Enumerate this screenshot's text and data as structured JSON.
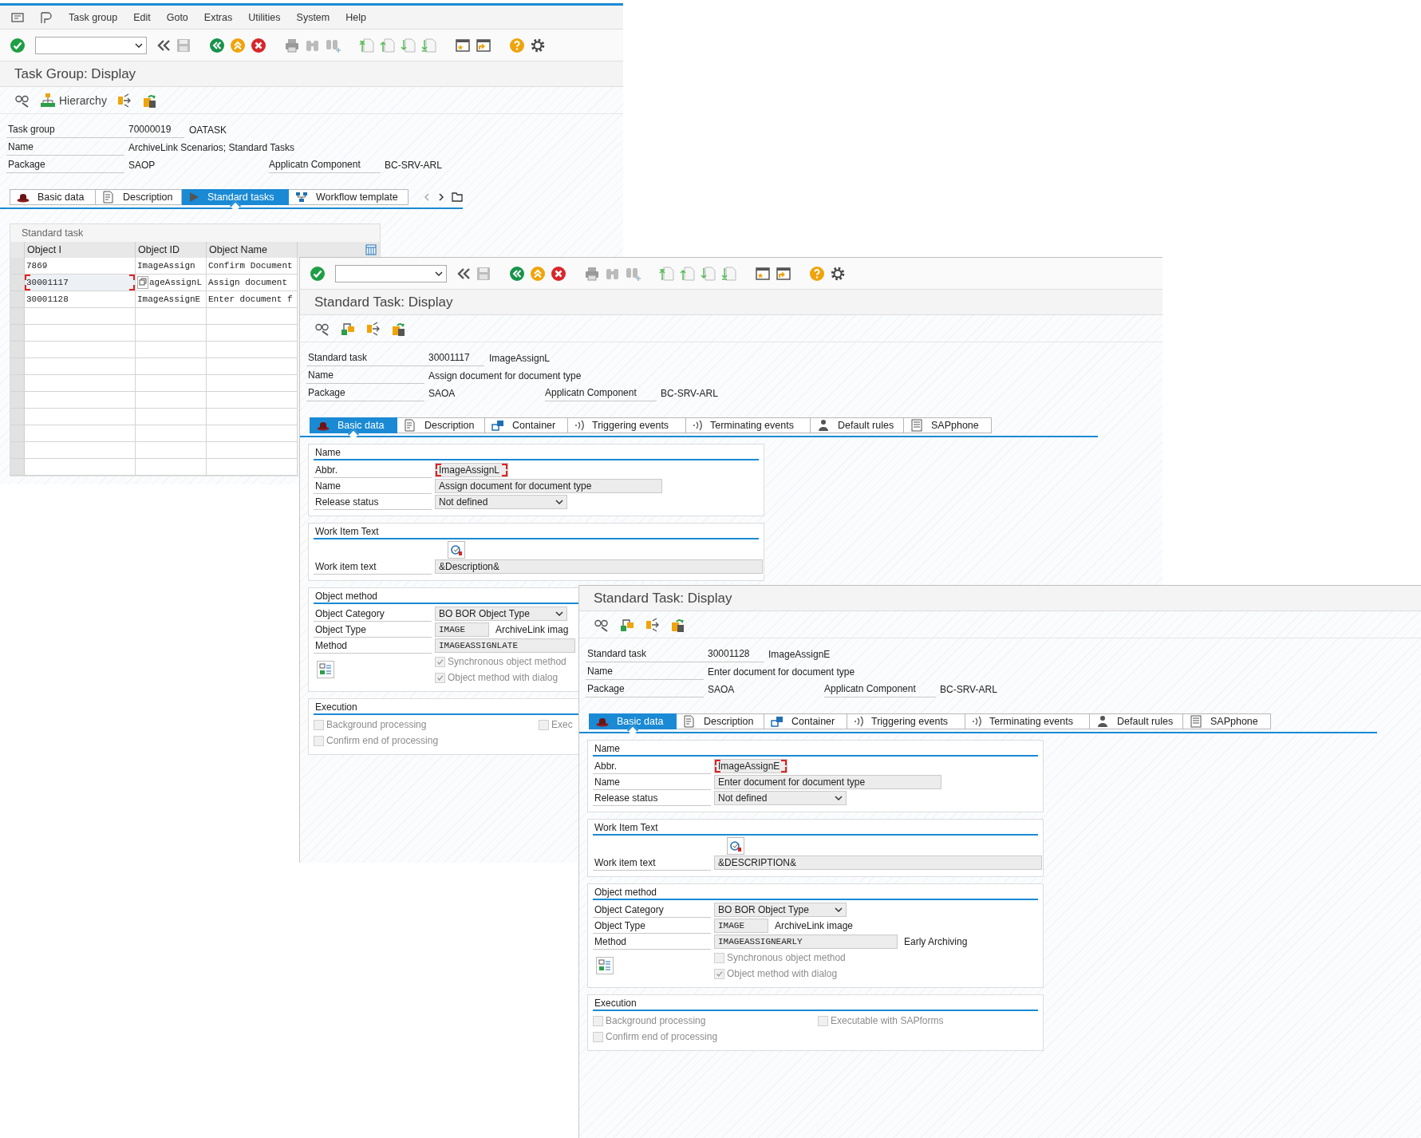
{
  "windows": [
    {
      "kind": "task_group",
      "menu": [
        "Task group",
        "Edit",
        "Goto",
        "Extras",
        "Utilities",
        "System",
        "Help"
      ],
      "title": "Task Group: Display",
      "hierarchy_label": "Hierarchy",
      "header": [
        {
          "label": "Task group",
          "value": "70000019",
          "value_2": "OATASK"
        },
        {
          "label": "Name",
          "value": "ArchiveLink Scenarios; Standard Tasks"
        },
        {
          "label": "Package",
          "value": "SAOP",
          "side_label": "Applicatn Component",
          "side_value": "BC-SRV-ARL"
        }
      ],
      "tabs": [
        {
          "label": "Basic data",
          "selected": false
        },
        {
          "label": "Description",
          "selected": false
        },
        {
          "label": "Standard tasks",
          "selected": true
        },
        {
          "label": "Workflow template",
          "selected": false
        }
      ],
      "table": {
        "title": "Standard task",
        "columns": [
          "Object I",
          "Object ID",
          "Object Name"
        ],
        "rows": [
          {
            "cells": [
              "7869",
              "ImageAssign",
              "Confirm Document"
            ],
            "focused": false
          },
          {
            "cells": [
              "30001117",
              "ageAssignL",
              "Assign document"
            ],
            "focused": true
          },
          {
            "cells": [
              "30001128",
              "ImageAssignE",
              "Enter document f"
            ],
            "focused": false
          }
        ]
      }
    },
    {
      "kind": "standard_task",
      "toolbar": true,
      "title": "Standard Task: Display",
      "header": [
        {
          "label": "Standard task",
          "value": "30001117",
          "value_2": "ImageAssignL"
        },
        {
          "label": "Name",
          "value": "Assign document for document type"
        },
        {
          "label": "Package",
          "value": "SAOA",
          "side_label": "Applicatn Component",
          "side_value": "BC-SRV-ARL"
        }
      ],
      "tabs": [
        {
          "label": "Basic data",
          "selected": true
        },
        {
          "label": "Description",
          "selected": false
        },
        {
          "label": "Container",
          "selected": false
        },
        {
          "label": "Triggering events",
          "selected": false
        },
        {
          "label": "Terminating events",
          "selected": false
        },
        {
          "label": "Default rules",
          "selected": false
        },
        {
          "label": "SAPphone",
          "selected": false
        }
      ],
      "name_section": {
        "title": "Name",
        "rows": [
          {
            "label": "Abbr.",
            "value": "ImageAssignL",
            "kind": "input",
            "focused": true
          },
          {
            "label": "Name",
            "value": "Assign document for document type",
            "kind": "input",
            "focused": false
          },
          {
            "label": "Release status",
            "value": "Not defined",
            "kind": "select",
            "focused": false
          }
        ]
      },
      "work_item": {
        "title": "Work Item Text",
        "label": "Work item text",
        "value": "&Description&"
      },
      "object_method": {
        "title": "Object method",
        "rows": [
          {
            "label": "Object Category",
            "value": "BO BOR Object Type",
            "kind": "select",
            "focused": false
          },
          {
            "label": "Object Type",
            "value": "IMAGE",
            "kind": "code",
            "focused": false,
            "note": "ArchiveLink imag"
          },
          {
            "label": "Method",
            "value": "IMAGEASSIGNLATE",
            "kind": "code",
            "focused": false
          }
        ],
        "checkboxes": [
          {
            "label": "Synchronous object method",
            "checked": true,
            "disabled": true
          },
          {
            "label": "Object method with dialog",
            "checked": true,
            "disabled": true
          }
        ]
      },
      "execution": {
        "title": "Execution",
        "checkboxes": [
          {
            "label": "Background processing",
            "checked": false,
            "disabled": true
          },
          {
            "label": "Confirm end of processing",
            "checked": false,
            "disabled": true
          },
          {
            "label": "Exec",
            "checked": false,
            "disabled": true
          }
        ]
      }
    },
    {
      "kind": "standard_task",
      "toolbar": false,
      "title": "Standard Task: Display",
      "header": [
        {
          "label": "Standard task",
          "value": "30001128",
          "value_2": "ImageAssignE"
        },
        {
          "label": "Name",
          "value": "Enter document for document type"
        },
        {
          "label": "Package",
          "value": "SAOA",
          "side_label": "Applicatn Component",
          "side_value": "BC-SRV-ARL"
        }
      ],
      "tabs": [
        {
          "label": "Basic data",
          "selected": true
        },
        {
          "label": "Description",
          "selected": false
        },
        {
          "label": "Container",
          "selected": false
        },
        {
          "label": "Triggering events",
          "selected": false
        },
        {
          "label": "Terminating events",
          "selected": false
        },
        {
          "label": "Default rules",
          "selected": false
        },
        {
          "label": "SAPphone",
          "selected": false
        }
      ],
      "name_section": {
        "title": "Name",
        "rows": [
          {
            "label": "Abbr.",
            "value": "ImageAssignE",
            "kind": "input",
            "focused": true
          },
          {
            "label": "Name",
            "value": "Enter document for document type",
            "kind": "input",
            "focused": false
          },
          {
            "label": "Release status",
            "value": "Not defined",
            "kind": "select",
            "focused": false
          }
        ]
      },
      "work_item": {
        "title": "Work Item Text",
        "label": "Work item text",
        "value": "&DESCRIPTION&"
      },
      "object_method": {
        "title": "Object method",
        "rows": [
          {
            "label": "Object Category",
            "value": "BO BOR Object Type",
            "kind": "select",
            "focused": false
          },
          {
            "label": "Object Type",
            "value": "IMAGE",
            "kind": "code",
            "focused": false,
            "note": "ArchiveLink image"
          },
          {
            "label": "Method",
            "value": "IMAGEASSIGNEARLY",
            "kind": "code",
            "focused": false,
            "note": "Early Archiving"
          }
        ],
        "checkboxes": [
          {
            "label": "Synchronous object method",
            "checked": false,
            "disabled": true
          },
          {
            "label": "Object method with dialog",
            "checked": true,
            "disabled": true
          }
        ]
      },
      "execution": {
        "title": "Execution",
        "checkboxes": [
          {
            "label": "Background processing",
            "checked": false,
            "disabled": true
          },
          {
            "label": "Confirm end of processing",
            "checked": false,
            "disabled": true
          },
          {
            "label": "Executable with SAPforms",
            "checked": false,
            "disabled": true
          }
        ]
      }
    }
  ]
}
